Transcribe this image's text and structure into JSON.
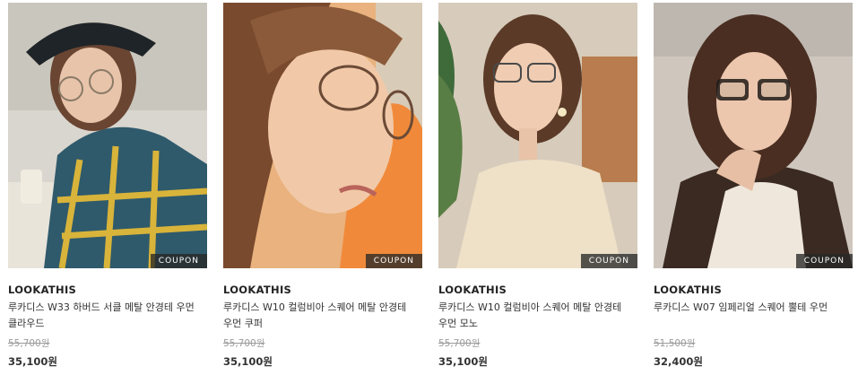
{
  "products": [
    {
      "image_icon": "product-photo",
      "coupon": "COUPON",
      "brand": "LOOKATHIS",
      "name": "루카디스 W33 하버드 서클 메탈 안경테 우먼 클라우드",
      "original_price": "55,700원",
      "price": "35,100원"
    },
    {
      "image_icon": "product-photo",
      "coupon": "COUPON",
      "brand": "LOOKATHIS",
      "name": "루카디스 W10 컬럼비아 스퀘어 메탈 안경테 우먼 쿠퍼",
      "original_price": "55,700원",
      "price": "35,100원"
    },
    {
      "image_icon": "product-photo",
      "coupon": "COUPON",
      "brand": "LOOKATHIS",
      "name": "루카디스 W10 컬럼비아 스퀘어 메탈 안경테 우먼 모노",
      "original_price": "55,700원",
      "price": "35,100원"
    },
    {
      "image_icon": "product-photo",
      "coupon": "COUPON",
      "brand": "LOOKATHIS",
      "name": "루카디스 W07 임페리얼 스퀘어 뿔테 우먼",
      "original_price": "51,500원",
      "price": "32,400원"
    }
  ]
}
